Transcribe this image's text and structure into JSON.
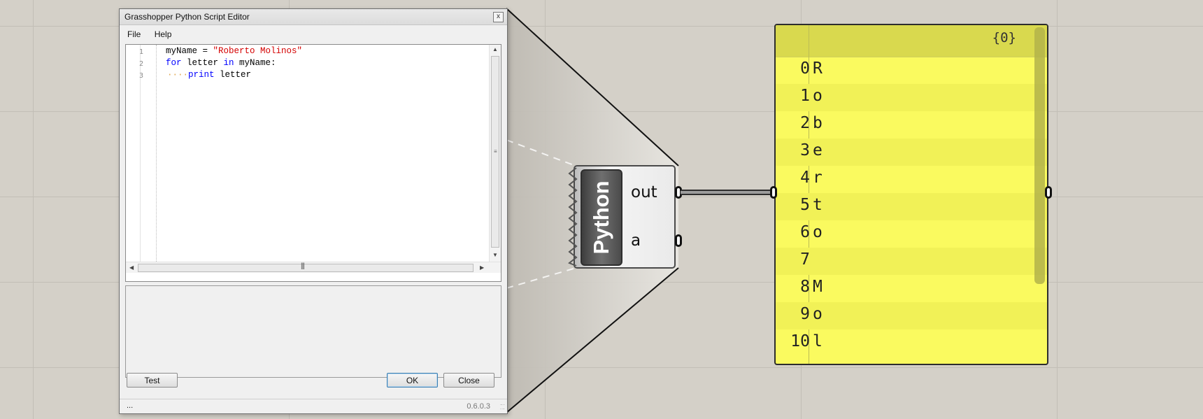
{
  "editor": {
    "title": "Grasshopper Python Script Editor",
    "close_glyph": "x",
    "menu": [
      "File",
      "Help"
    ],
    "line_numbers": [
      "1",
      "2",
      "3"
    ],
    "code": {
      "line1": {
        "var": "myName",
        "op": " = ",
        "string": "\"Roberto Molinos\""
      },
      "line2": {
        "kw1": "for",
        "t1": " letter ",
        "kw2": "in",
        "t2": " myName:"
      },
      "line3": {
        "indent": "····",
        "kw": "print",
        "t": " letter"
      }
    },
    "buttons": {
      "test": "Test",
      "ok": "OK",
      "close": "Close"
    },
    "status": {
      "left": "...",
      "version": "0.6.0.3"
    }
  },
  "component": {
    "name": "Python",
    "outputs": [
      "out",
      "a"
    ]
  },
  "panel": {
    "path": "{0}",
    "rows": [
      {
        "index": "0",
        "value": "R"
      },
      {
        "index": "1",
        "value": "o"
      },
      {
        "index": "2",
        "value": "b"
      },
      {
        "index": "3",
        "value": "e"
      },
      {
        "index": "4",
        "value": "r"
      },
      {
        "index": "5",
        "value": "t"
      },
      {
        "index": "6",
        "value": "o"
      },
      {
        "index": "7",
        "value": ""
      },
      {
        "index": "8",
        "value": "M"
      },
      {
        "index": "9",
        "value": "o"
      },
      {
        "index": "10",
        "value": "l"
      }
    ]
  },
  "colors": {
    "panel_bg": "#fafa5f",
    "panel_header": "#d9d94e",
    "keyword": "#0000ff",
    "string": "#d40000",
    "canvas": "#d4d0c8"
  }
}
